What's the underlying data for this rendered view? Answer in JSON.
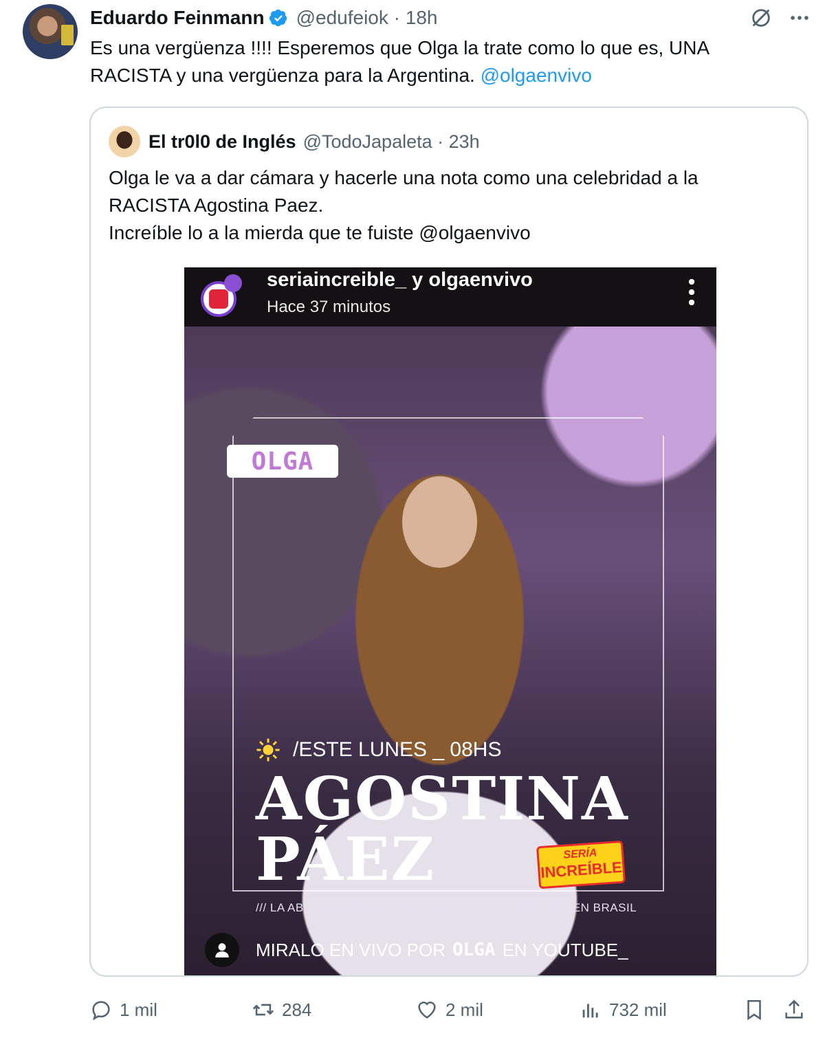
{
  "tweet": {
    "author_name": "Eduardo Feinmann",
    "author_handle": "@edufeiok · 18h",
    "text_main": "Es una vergüenza !!!!  Esperemos que Olga la trate como lo que es, UNA RACISTA y una vergüenza para la Argentina. ",
    "text_mention": "@olgaenvivo"
  },
  "quote": {
    "author_name": "El tr0l0 de Inglés",
    "author_handle": "@TodoJapaleta · 23h",
    "line1": "Olga le va a dar cámara y hacerle una nota como una celebridad a la",
    "line2": "RACISTA Agostina Paez.",
    "line3": "Increíble lo a la mierda que te fuiste @olgaenvivo"
  },
  "story": {
    "users": "seriaincreible_ y olgaenvivo",
    "time": "Hace 37 minutos",
    "olga_tag": "OLGA",
    "este": "/ESTE LUNES _ 08HS",
    "name1": "AGOSTINA",
    "name2": "PÁEZ",
    "seria_t1": "SERÍA",
    "seria_t2": "INCREÍBLE",
    "subtitle": "/// LA ABOGADA ARGENTINA QUE ESTUVO DETENIDA EN BRASIL",
    "miralo_a": "MIRALO EN VIVO POR",
    "miralo_b": "OLGA",
    "miralo_c": "EN YOUTUBE_"
  },
  "actions": {
    "replies": "1 mil",
    "reposts": "284",
    "likes": "2 mil",
    "views": "732 mil"
  },
  "icons": [
    "verified-badge-icon",
    "grok-icon",
    "more-icon",
    "reply-icon",
    "repost-icon",
    "like-icon",
    "views-icon",
    "bookmark-icon",
    "share-icon"
  ],
  "colors": {
    "link": "#1d9bf0",
    "muted": "#536471",
    "border": "#cfd9de"
  }
}
